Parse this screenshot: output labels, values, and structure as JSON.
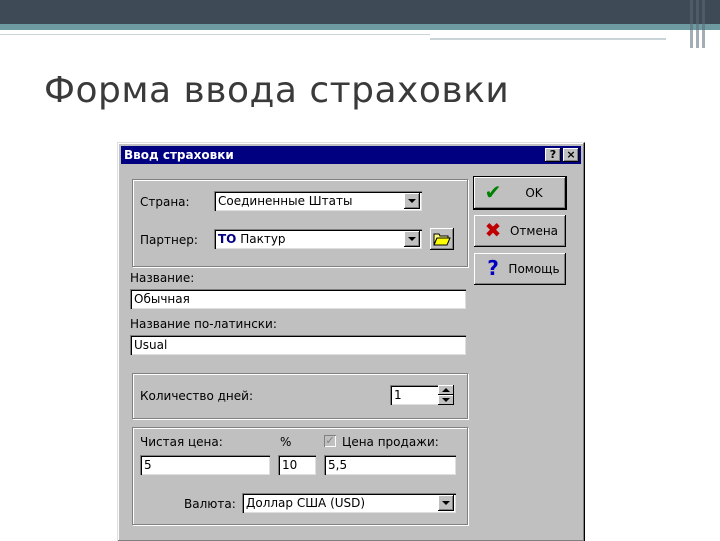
{
  "slide": {
    "title": "Форма ввода страховки"
  },
  "dialog": {
    "title": "Ввод страховки",
    "help_button": "?",
    "close_button": "×",
    "country": {
      "label": "Страна:",
      "value": "Соединенные Штаты"
    },
    "partner": {
      "label": "Партнер:",
      "badge": "ТО",
      "value": "Пактур"
    },
    "name": {
      "label": "Название:",
      "value": "Обычная"
    },
    "latin_name": {
      "label": "Название по-латински:",
      "value": "Usual"
    },
    "days": {
      "label": "Количество дней:",
      "value": "1"
    },
    "net_price": {
      "label": "Чистая цена:",
      "value": "5"
    },
    "percent": {
      "label": "%",
      "value": "10"
    },
    "sale_price": {
      "label": "Цена продажи:",
      "value": "5,5",
      "checked": true
    },
    "currency": {
      "label": "Валюта:",
      "value": "Доллар США (USD)"
    },
    "buttons": {
      "ok": "OK",
      "cancel": "Отмена",
      "help": "Помощь"
    },
    "colors": {
      "ok_icon": "#008000",
      "cancel_icon": "#c00000",
      "help_icon": "#0000c0",
      "titlebar": "#000080"
    }
  }
}
